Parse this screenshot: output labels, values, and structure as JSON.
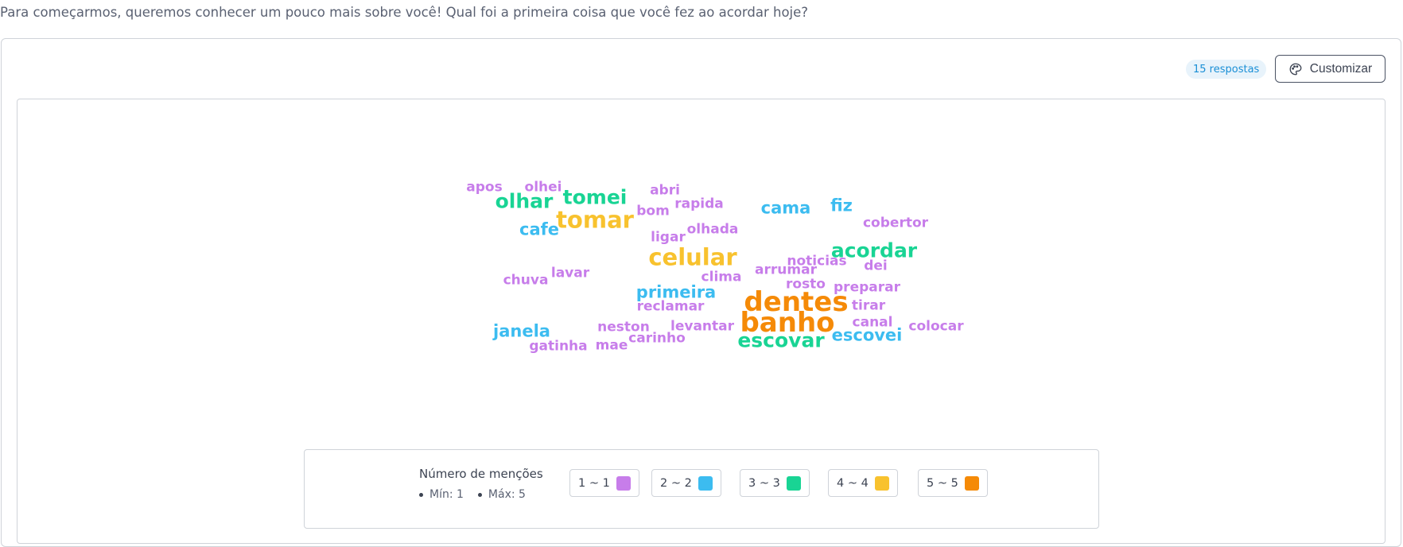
{
  "question": "Para começarmos, queremos conhecer um pouco mais sobre você! Qual foi a primeira coisa que você fez ao acordar hoje?",
  "header": {
    "badge": "15 respostas",
    "customize_label": "Customizar",
    "customize_icon": "palette-icon"
  },
  "colors": {
    "c1": "#c77dea",
    "c2": "#3cbcf0",
    "c3": "#19d494",
    "c4": "#f8c22e",
    "c5": "#f58a07"
  },
  "words": [
    {
      "text": "apos",
      "count": 1
    },
    {
      "text": "olhei",
      "count": 1
    },
    {
      "text": "olhar",
      "count": 3
    },
    {
      "text": "tomei",
      "count": 3
    },
    {
      "text": "abri",
      "count": 1
    },
    {
      "text": "rapida",
      "count": 1
    },
    {
      "text": "bom",
      "count": 1
    },
    {
      "text": "tomar",
      "count": 4
    },
    {
      "text": "cama",
      "count": 2
    },
    {
      "text": "fiz",
      "count": 2
    },
    {
      "text": "cobertor",
      "count": 1
    },
    {
      "text": "cafe",
      "count": 2
    },
    {
      "text": "olhada",
      "count": 1
    },
    {
      "text": "ligar",
      "count": 1
    },
    {
      "text": "acordar",
      "count": 3
    },
    {
      "text": "celular",
      "count": 4
    },
    {
      "text": "noticias",
      "count": 1
    },
    {
      "text": "dei",
      "count": 1
    },
    {
      "text": "arrumar",
      "count": 1
    },
    {
      "text": "chuva",
      "count": 1
    },
    {
      "text": "lavar",
      "count": 1
    },
    {
      "text": "clima",
      "count": 1
    },
    {
      "text": "rosto",
      "count": 1
    },
    {
      "text": "preparar",
      "count": 1
    },
    {
      "text": "primeira",
      "count": 2
    },
    {
      "text": "dentes",
      "count": 5
    },
    {
      "text": "reclamar",
      "count": 1
    },
    {
      "text": "tirar",
      "count": 1
    },
    {
      "text": "banho",
      "count": 5
    },
    {
      "text": "canal",
      "count": 1
    },
    {
      "text": "neston",
      "count": 1
    },
    {
      "text": "levantar",
      "count": 1
    },
    {
      "text": "colocar",
      "count": 1
    },
    {
      "text": "janela",
      "count": 2
    },
    {
      "text": "escovei",
      "count": 2
    },
    {
      "text": "carinho",
      "count": 1
    },
    {
      "text": "escovar",
      "count": 3
    },
    {
      "text": "gatinha",
      "count": 1
    },
    {
      "text": "mae",
      "count": 1
    }
  ],
  "legend": {
    "title": "Número de menções",
    "min_label": "Mín: 1",
    "max_label": "Máx: 5",
    "ranges": [
      {
        "label": "1 ~ 1",
        "color": "#c77dea"
      },
      {
        "label": "2 ~ 2",
        "color": "#3cbcf0"
      },
      {
        "label": "3 ~ 3",
        "color": "#19d494"
      },
      {
        "label": "4 ~ 4",
        "color": "#f8c22e"
      },
      {
        "label": "5 ~ 5",
        "color": "#f58a07"
      }
    ]
  }
}
